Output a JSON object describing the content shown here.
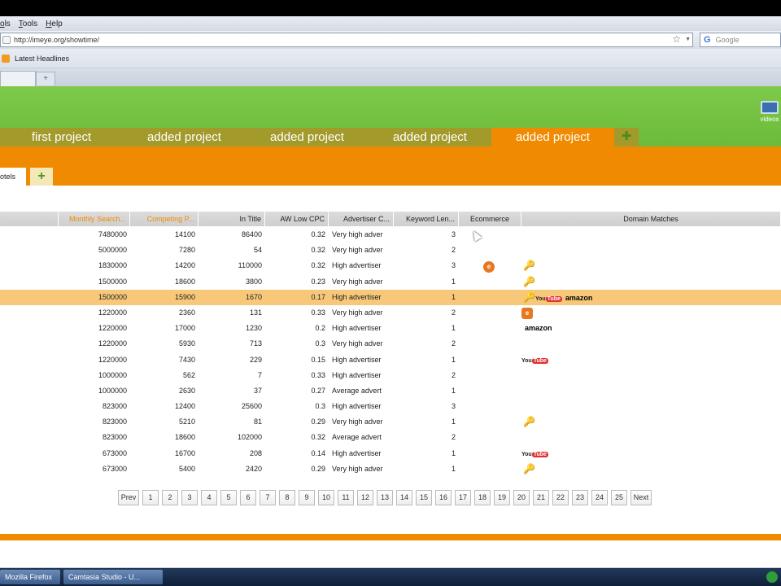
{
  "browser": {
    "menus": [
      "ols",
      "Tools",
      "Help"
    ],
    "url": "http://imeye.org/showtime/",
    "search_placeholder": "Google",
    "bookmark_label": "Latest Headlines",
    "new_tab_label": "+"
  },
  "app": {
    "video_label": "videos",
    "projects": [
      {
        "label": "first project",
        "active": false
      },
      {
        "label": "added project",
        "active": false
      },
      {
        "label": "added project",
        "active": false
      },
      {
        "label": "added project",
        "active": false
      },
      {
        "label": "added project",
        "active": true
      }
    ],
    "sub_tab_label": "otels",
    "sub_add_label": "+"
  },
  "grid": {
    "columns": [
      "",
      "Monthly Search...",
      "Competing P...",
      "In Title",
      "AW Low CPC",
      "Advertiser C...",
      "Keyword Len...",
      "Ecommerce",
      "Domain Matches"
    ],
    "rows": [
      {
        "monthly": "7480000",
        "competing": "14100",
        "in_title": "86400",
        "cpc": "0.32",
        "advertiser": "Very high adver",
        "kw_len": "3",
        "ecom": "",
        "domain": []
      },
      {
        "monthly": "5000000",
        "competing": "7280",
        "in_title": "54",
        "cpc": "0.32",
        "advertiser": "Very high adver",
        "kw_len": "2",
        "ecom": "",
        "domain": []
      },
      {
        "monthly": "1830000",
        "competing": "14200",
        "in_title": "110000",
        "cpc": "0.32",
        "advertiser": "High advertiser",
        "kw_len": "3",
        "ecom": "ebay",
        "domain": [
          "key"
        ]
      },
      {
        "monthly": "1500000",
        "competing": "18600",
        "in_title": "3800",
        "cpc": "0.23",
        "advertiser": "Very high adver",
        "kw_len": "1",
        "ecom": "",
        "domain": [
          "key"
        ]
      },
      {
        "monthly": "1500000",
        "competing": "15900",
        "in_title": "1670",
        "cpc": "0.17",
        "advertiser": "High advertiser",
        "kw_len": "1",
        "ecom": "",
        "domain": [
          "key",
          "youtube",
          "amazon"
        ],
        "selected": true
      },
      {
        "monthly": "1220000",
        "competing": "2360",
        "in_title": "131",
        "cpc": "0.33",
        "advertiser": "Very high adver",
        "kw_len": "2",
        "ecom": "",
        "domain": [
          "ebay"
        ]
      },
      {
        "monthly": "1220000",
        "competing": "17000",
        "in_title": "1230",
        "cpc": "0.2",
        "advertiser": "High advertiser",
        "kw_len": "1",
        "ecom": "",
        "domain": [
          "amazon"
        ]
      },
      {
        "monthly": "1220000",
        "competing": "5930",
        "in_title": "713",
        "cpc": "0.3",
        "advertiser": "Very high adver",
        "kw_len": "2",
        "ecom": "",
        "domain": []
      },
      {
        "monthly": "1220000",
        "competing": "7430",
        "in_title": "229",
        "cpc": "0.15",
        "advertiser": "High advertiser",
        "kw_len": "1",
        "ecom": "",
        "domain": [
          "youtube"
        ]
      },
      {
        "monthly": "1000000",
        "competing": "562",
        "in_title": "7",
        "cpc": "0.33",
        "advertiser": "High advertiser",
        "kw_len": "2",
        "ecom": "",
        "domain": []
      },
      {
        "monthly": "1000000",
        "competing": "2630",
        "in_title": "37",
        "cpc": "0.27",
        "advertiser": "Average advert",
        "kw_len": "1",
        "ecom": "",
        "domain": []
      },
      {
        "monthly": "823000",
        "competing": "12400",
        "in_title": "25600",
        "cpc": "0.3",
        "advertiser": "High advertiser",
        "kw_len": "3",
        "ecom": "",
        "domain": []
      },
      {
        "monthly": "823000",
        "competing": "5210",
        "in_title": "81",
        "cpc": "0.29",
        "advertiser": "Very high adver",
        "kw_len": "1",
        "ecom": "",
        "domain": [
          "key"
        ]
      },
      {
        "monthly": "823000",
        "competing": "18600",
        "in_title": "102000",
        "cpc": "0.32",
        "advertiser": "Average advert",
        "kw_len": "2",
        "ecom": "",
        "domain": []
      },
      {
        "monthly": "673000",
        "competing": "16700",
        "in_title": "208",
        "cpc": "0.14",
        "advertiser": "High advertiser",
        "kw_len": "1",
        "ecom": "",
        "domain": [
          "youtube"
        ]
      },
      {
        "monthly": "673000",
        "competing": "5400",
        "in_title": "2420",
        "cpc": "0.29",
        "advertiser": "Very high adver",
        "kw_len": "1",
        "ecom": "",
        "domain": [
          "key"
        ]
      }
    ]
  },
  "pager": {
    "prev": "Prev",
    "next": "Next",
    "pages": [
      "1",
      "2",
      "3",
      "4",
      "5",
      "6",
      "7",
      "8",
      "9",
      "10",
      "11",
      "12",
      "13",
      "14",
      "15",
      "16",
      "17",
      "18",
      "19",
      "20",
      "21",
      "22",
      "23",
      "24",
      "25"
    ]
  },
  "taskbar": {
    "items": [
      "Mozilla Firefox",
      "Camtasia Studio - U..."
    ]
  },
  "icons": {
    "youtube_text": "You",
    "youtube_tube": "Tube",
    "amazon_text": "amazon",
    "ebay_glyph": "e"
  },
  "colors": {
    "header_green": "#6cbb3a",
    "tab_olive": "#a39a2c",
    "accent_orange": "#f08a00",
    "selected_row": "#f8c87a"
  }
}
